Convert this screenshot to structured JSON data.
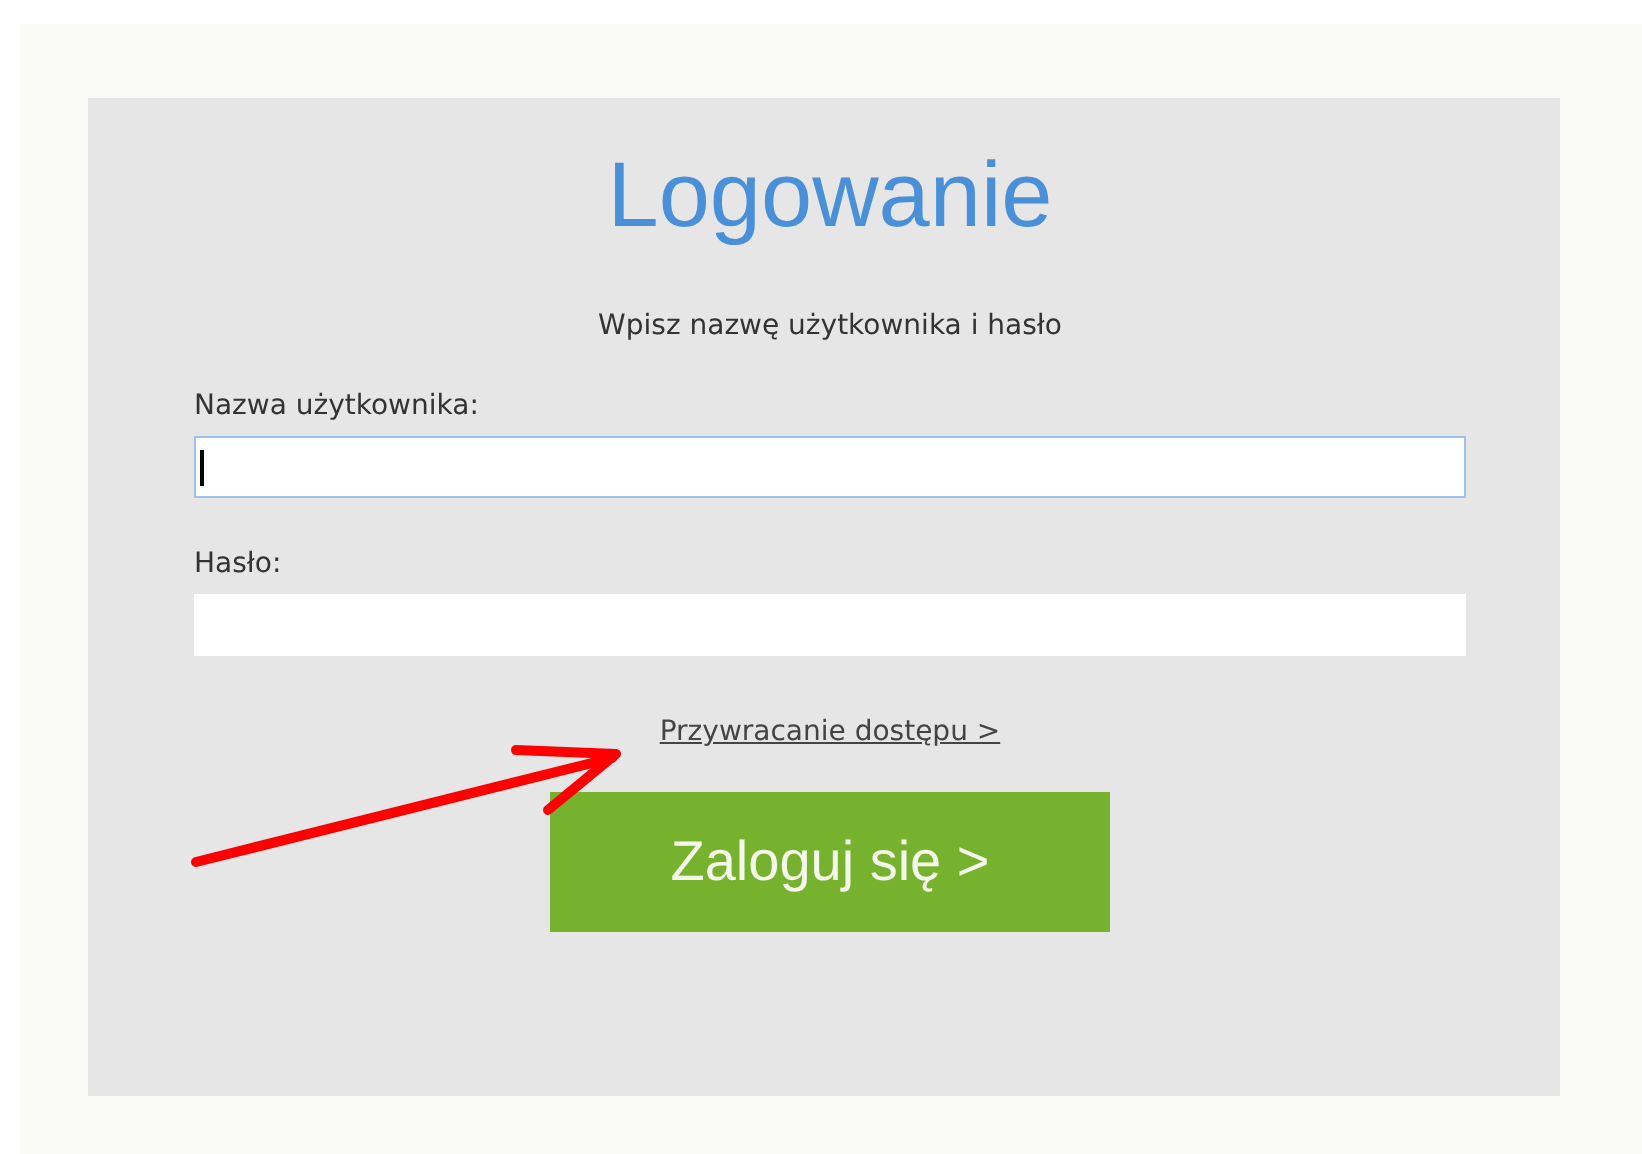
{
  "title": "Logowanie",
  "subtitle": "Wpisz nazwę użytkownika i hasło",
  "fields": [
    {
      "label": "Nazwa użytkownika:",
      "focused": true
    },
    {
      "label": "Hasło:",
      "focused": false
    }
  ],
  "recovery_link": "Przywracanie dostępu >",
  "login_button": "Zaloguj się >"
}
